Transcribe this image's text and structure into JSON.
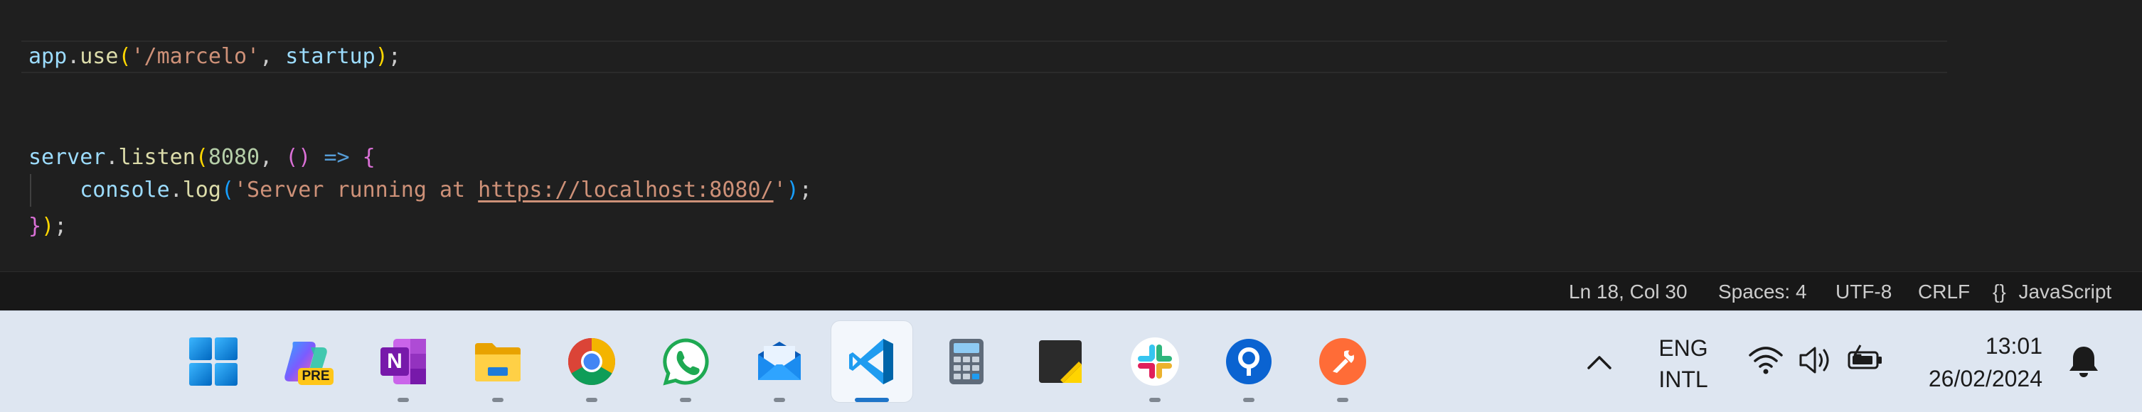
{
  "editor": {
    "lines": [
      {
        "tokens": [
          {
            "t": "app",
            "c": "t-var"
          },
          {
            "t": "."
          },
          {
            "t": "use",
            "c": "t-fn"
          },
          {
            "t": "(",
            "c": "t-br1"
          },
          {
            "t": "'/marcelo'",
            "c": "t-str"
          },
          {
            "t": ", "
          },
          {
            "t": "startup",
            "c": "t-var"
          },
          {
            "t": ")",
            "c": "t-br1"
          },
          {
            "t": ";"
          }
        ]
      },
      {
        "tokens": [
          {
            "t": "server",
            "c": "t-var"
          },
          {
            "t": "."
          },
          {
            "t": "listen",
            "c": "t-fn"
          },
          {
            "t": "(",
            "c": "t-br1"
          },
          {
            "t": "8080",
            "c": "t-num"
          },
          {
            "t": ", "
          },
          {
            "t": "()",
            "c": "t-br2"
          },
          {
            "t": " "
          },
          {
            "t": "=>",
            "c": "t-kw"
          },
          {
            "t": " "
          },
          {
            "t": "{",
            "c": "t-br2"
          }
        ]
      },
      {
        "tokens": [
          {
            "t": "    "
          },
          {
            "t": "console",
            "c": "t-var"
          },
          {
            "t": "."
          },
          {
            "t": "log",
            "c": "t-fn"
          },
          {
            "t": "(",
            "c": "t-br3"
          },
          {
            "t": "'Server running at ",
            "c": "t-str"
          },
          {
            "t": "https://localhost:8080/",
            "c": "t-str t-link"
          },
          {
            "t": "'",
            "c": "t-str"
          },
          {
            "t": ")",
            "c": "t-br3"
          },
          {
            "t": ";"
          }
        ]
      },
      {
        "tokens": [
          {
            "t": "}",
            "c": "t-br2"
          },
          {
            "t": ")",
            "c": "t-br1"
          },
          {
            "t": ";"
          }
        ]
      }
    ]
  },
  "statusbar": {
    "position": "Ln 18, Col 30",
    "indent": "Spaces: 4",
    "encoding": "UTF-8",
    "eol": "CRLF",
    "language_icon": "{}",
    "language": "JavaScript"
  },
  "taskbar": {
    "apps": [
      {
        "name": "start",
        "icon": "windows-start-icon",
        "running": false,
        "active": false
      },
      {
        "name": "copilot",
        "icon": "copilot-icon",
        "badge": "PRE",
        "running": false,
        "active": false
      },
      {
        "name": "onenote",
        "icon": "onenote-icon",
        "letter": "N",
        "running": true,
        "active": false
      },
      {
        "name": "file-explorer",
        "icon": "folder-icon",
        "running": true,
        "active": false
      },
      {
        "name": "chrome",
        "icon": "chrome-icon",
        "running": true,
        "active": false
      },
      {
        "name": "whatsapp",
        "icon": "whatsapp-icon",
        "running": true,
        "active": false
      },
      {
        "name": "mail",
        "icon": "mail-icon",
        "running": true,
        "active": false
      },
      {
        "name": "vscode",
        "icon": "vscode-icon",
        "running": true,
        "active": true
      },
      {
        "name": "calculator",
        "icon": "calculator-icon",
        "running": false,
        "active": false
      },
      {
        "name": "sticky-notes",
        "icon": "sticky-notes-icon",
        "running": false,
        "active": false
      },
      {
        "name": "slack",
        "icon": "slack-icon",
        "running": true,
        "active": false
      },
      {
        "name": "blue-app",
        "icon": "blue-circle-app-icon",
        "running": true,
        "active": false
      },
      {
        "name": "postman",
        "icon": "postman-icon",
        "running": true,
        "active": false
      }
    ],
    "tray": {
      "overflow_icon": "chevron-up-icon",
      "lang_line1": "ENG",
      "lang_line2": "INTL",
      "wifi_icon": "wifi-icon",
      "volume_icon": "volume-icon",
      "battery_icon": "battery-charging-icon",
      "time": "13:01",
      "date": "26/02/2024",
      "notification_icon": "bell-icon"
    }
  },
  "colors": {
    "editor_bg": "#1f1f1f",
    "statusbar_bg": "#181818",
    "taskbar_bg": "#dee6f1",
    "active_indicator": "#1e74c8"
  }
}
